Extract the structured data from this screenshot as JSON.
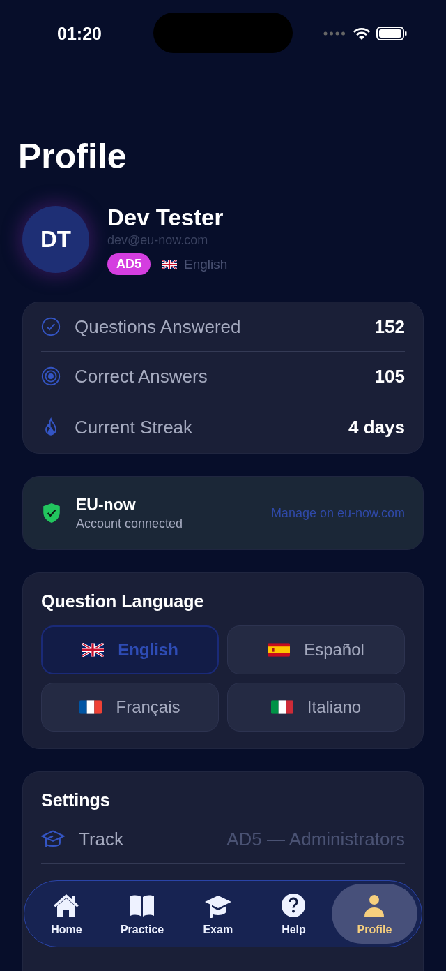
{
  "status_bar": {
    "time": "01:20"
  },
  "title": "Profile",
  "profile": {
    "initials": "DT",
    "name": "Dev Tester",
    "email": "dev@eu-now.com",
    "badge": "AD5",
    "language": {
      "kind": "uk",
      "label": "English"
    }
  },
  "stats": [
    {
      "kind": "check",
      "label": "Questions Answered",
      "value": "152"
    },
    {
      "kind": "target",
      "label": "Correct Answers",
      "value": "105"
    },
    {
      "kind": "flame",
      "label": "Current Streak",
      "value": "4 days"
    }
  ],
  "account": {
    "name": "EU-now",
    "status": "Account connected",
    "link": "Manage on eu-now.com"
  },
  "question_language": {
    "title": "Question Language",
    "options": [
      {
        "kind": "uk",
        "label": "English",
        "selected": true
      },
      {
        "kind": "es",
        "label": "Español",
        "selected": false
      },
      {
        "kind": "fr",
        "label": "Français",
        "selected": false
      },
      {
        "kind": "it",
        "label": "Italiano",
        "selected": false
      }
    ]
  },
  "settings": {
    "title": "Settings",
    "rows": [
      {
        "kind": "cap",
        "label": "Track",
        "value": "AD5 — Administrators"
      }
    ]
  },
  "tab_bar": [
    {
      "kind": "home",
      "label": "Home",
      "selected": false
    },
    {
      "kind": "book",
      "label": "Practice",
      "selected": false
    },
    {
      "kind": "cap",
      "label": "Exam",
      "selected": false
    },
    {
      "kind": "help",
      "label": "Help",
      "selected": false
    },
    {
      "kind": "person",
      "label": "Profile",
      "selected": true
    }
  ]
}
